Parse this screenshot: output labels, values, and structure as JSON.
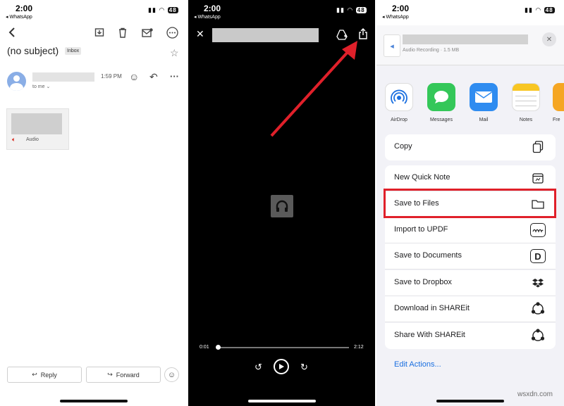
{
  "status": {
    "time": "2:00",
    "back_app": "◂ WhatsApp",
    "battery": "48"
  },
  "email": {
    "subject": "(no subject)",
    "label": "Inbox",
    "time": "1:59 PM",
    "to": "to me",
    "attachment_label": "Audio",
    "reply_label": "Reply",
    "forward_label": "Forward"
  },
  "player": {
    "elapsed": "0:01",
    "duration": "2:12",
    "progress": 0.01
  },
  "share": {
    "file_subtitle": "Audio Recording · 1.5 MB",
    "apps": [
      {
        "name": "AirDrop"
      },
      {
        "name": "Messages"
      },
      {
        "name": "Mail"
      },
      {
        "name": "Notes"
      },
      {
        "name": "Fre"
      }
    ],
    "copy_label": "Copy",
    "actions": [
      {
        "label": "New Quick Note"
      },
      {
        "label": "Save to Files"
      },
      {
        "label": "Import to UPDF"
      },
      {
        "label": "Save to Documents"
      },
      {
        "label": "Save to Dropbox"
      },
      {
        "label": "Download in SHAREit"
      },
      {
        "label": "Share With SHAREit"
      }
    ],
    "edit_actions": "Edit Actions..."
  },
  "watermark": "wsxdn.com",
  "colors": {
    "highlight": "#e0202a",
    "ios_blue": "#1a6fe0",
    "gmail_red": "#d93025"
  }
}
